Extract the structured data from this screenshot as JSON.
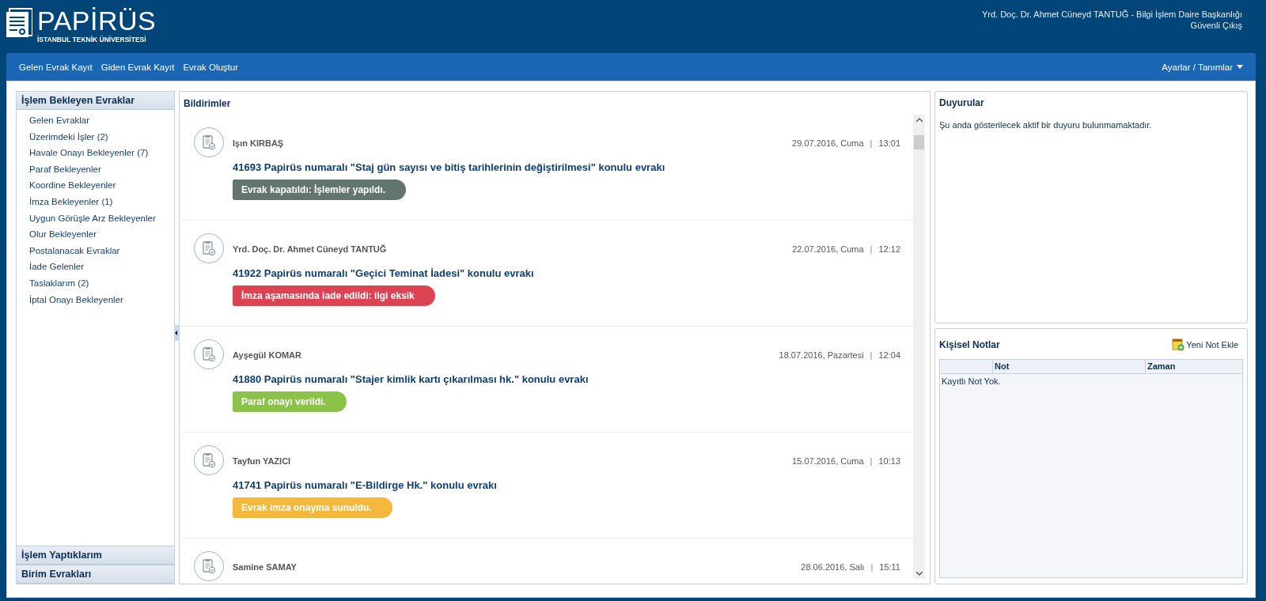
{
  "header": {
    "logo_title": "PAPİRÜS",
    "logo_subtitle": "İSTANBUL TEKNİK ÜNİVERSİTESİ",
    "user": "Yrd. Doç. Dr. Ahmet Cüneyd TANTUĞ - Bilgi İşlem Daire Başkanlığı",
    "logout": "Güvenli Çıkış"
  },
  "nav": {
    "items": [
      "Gelen Evrak Kayıt",
      "Giden Evrak Kayıt",
      "Evrak Oluştur"
    ],
    "settings": "Ayarlar / Tanımlar"
  },
  "sidebar": {
    "sections": [
      {
        "title": "İşlem Bekleyen Evraklar",
        "expanded": true,
        "items": [
          "Gelen Evraklar",
          "Üzerimdeki İşler (2)",
          "Havale Onayı Bekleyenler (7)",
          "Paraf Bekleyenler",
          "Koordine Bekleyenler",
          "İmza Bekleyenler (1)",
          "Uygun Görüşle Arz Bekleyenler",
          "Olur Bekleyenler",
          "Postalanacak Evraklar",
          "İade Gelenler",
          "Taslaklarım (2)",
          "İptal Onayı Bekleyenler"
        ]
      },
      {
        "title": "İşlem Yaptıklarım",
        "expanded": false
      },
      {
        "title": "Birim Evrakları",
        "expanded": false
      }
    ]
  },
  "notifications": {
    "title": "Bildirimler",
    "items": [
      {
        "name": "Işın KIRBAŞ",
        "date": "29.07.2016, Cuma",
        "separator": "|",
        "time": "13:01",
        "subject": "41693 Papirüs numaralı \"Staj gün sayısı ve bitiş tarihlerinin değiştirilmesi\" konulu evrakı",
        "status": "Evrak kapatıldı: İşlemler yapıldı.",
        "color": "#627571"
      },
      {
        "name": "Yrd. Doç. Dr. Ahmet Cüneyd TANTUĞ",
        "date": "22.07.2016, Cuma",
        "separator": "|",
        "time": "12:12",
        "subject": "41922 Papirüs numaralı \"Geçici Teminat İadesi\" konulu evrakı",
        "status": "İmza aşamasında iade edildi: ilgi eksik",
        "color": "#dc4454"
      },
      {
        "name": "Ayşegül KOMAR",
        "date": "18.07.2016, Pazartesi",
        "separator": "|",
        "time": "12:04",
        "subject": "41880 Papirüs numaralı \"Stajer kimlik kartı çıkarılması hk.\" konulu evrakı",
        "status": "Paraf onayı verildi.",
        "color": "#8bc34a"
      },
      {
        "name": "Tayfun YAZICI",
        "date": "15.07.2016, Cuma",
        "separator": "|",
        "time": "10:13",
        "subject": "41741 Papirüs numaralı \"E-Bildirge Hk.\" konulu evrakı",
        "status": "Evrak imza onayına sunuldu.",
        "color": "#f5b83d"
      },
      {
        "name": "Samine SAMAY",
        "date": "28.06.2016, Salı",
        "separator": "|",
        "time": "15:11"
      }
    ]
  },
  "announcements": {
    "title": "Duyurular",
    "message": "Şu anda gösterilecek aktif bir duyuru bulunmamaktadır."
  },
  "notes": {
    "title": "Kişisel Notlar",
    "add_button": "Yeni Not Ekle",
    "columns": [
      {
        "label": "Not"
      },
      {
        "label": "Zaman"
      }
    ],
    "empty_message": "Kayıtlı Not Yok."
  }
}
